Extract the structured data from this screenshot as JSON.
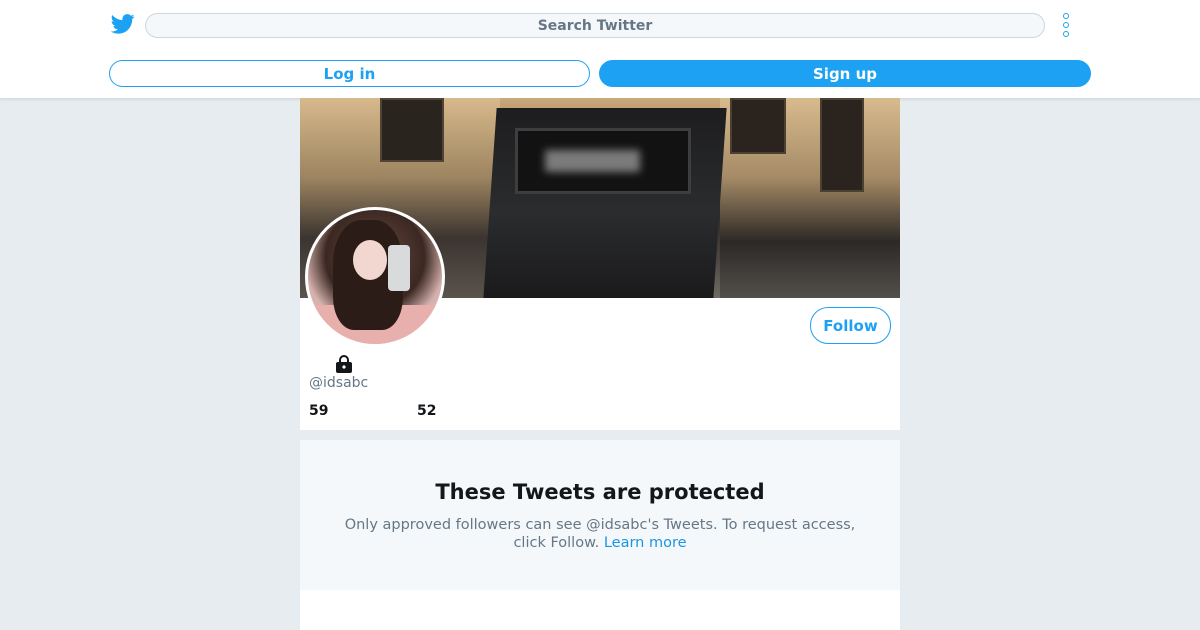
{
  "header": {
    "search_placeholder": "Search Twitter",
    "login_label": "Log in",
    "signup_label": "Sign up"
  },
  "profile": {
    "follow_label": "Follow",
    "handle": "@idsabc",
    "count_a": "59",
    "count_b": "52"
  },
  "protected": {
    "title": "These Tweets are protected",
    "message": "Only approved followers can see @idsabc's Tweets. To request access, click Follow.",
    "learn_more": "Learn more"
  },
  "icons": {
    "logo": "twitter-bird-icon",
    "more": "more-vertical-icon",
    "lock": "lock-icon"
  },
  "colors": {
    "brand": "#1da1f2",
    "background": "#e6ecf0",
    "muted_text": "#657786"
  }
}
